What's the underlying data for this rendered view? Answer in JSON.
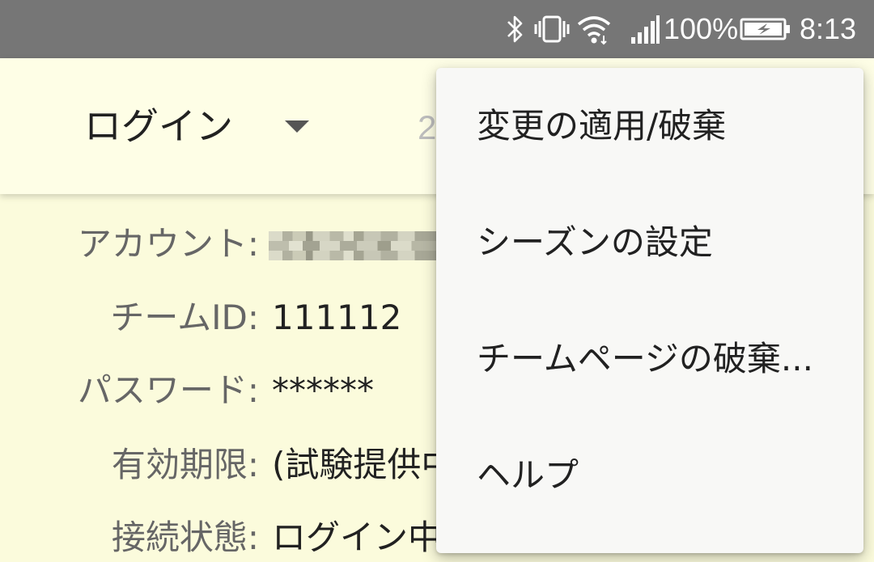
{
  "status_bar": {
    "icons": [
      "bluetooth-icon",
      "vibrate-icon",
      "wifi-icon",
      "signal-icon",
      "battery-charging-icon"
    ],
    "battery_percent": "100%",
    "time": "8:13"
  },
  "toolbar": {
    "title": "ログイン",
    "partial_text": "2"
  },
  "account_info": {
    "rows": [
      {
        "label": "アカウント:",
        "value": ""
      },
      {
        "label": "チームID:",
        "value": "111112"
      },
      {
        "label": "パスワード:",
        "value": "******"
      },
      {
        "label": "有効期限:",
        "value": "(試験提供中"
      },
      {
        "label": "接続状態:",
        "value": "ログイン中"
      }
    ]
  },
  "overflow_menu": {
    "items": [
      {
        "label": "変更の適用/破棄"
      },
      {
        "label": "シーズンの設定"
      },
      {
        "label": "チームページの破棄..."
      },
      {
        "label": "ヘルプ"
      }
    ]
  },
  "colors": {
    "status_bar": "#767676",
    "toolbar_bg": "#fefee6",
    "content_bg": "#fbfbdc",
    "menu_bg": "#f8f8f6"
  }
}
